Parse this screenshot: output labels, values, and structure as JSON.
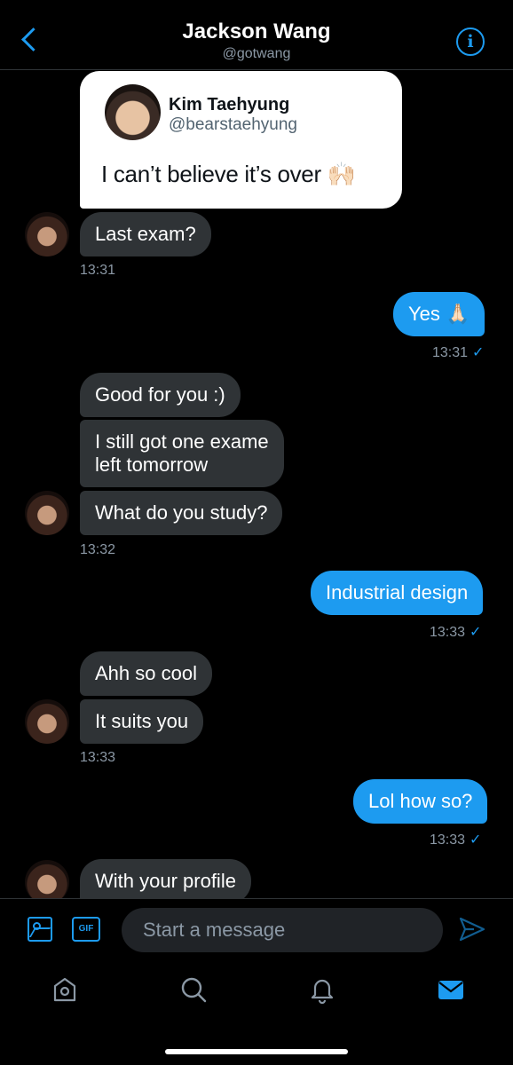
{
  "header": {
    "name": "Jackson Wang",
    "handle": "@gotwang"
  },
  "quoted_tweet": {
    "name": "Kim Taehyung",
    "handle": "@bearstaehyung",
    "text": "I can’t believe it’s over 🙌🏻"
  },
  "messages": [
    {
      "text": "Last exam?"
    },
    {
      "time": "13:31"
    },
    {
      "text": "Yes 🙏🏻"
    },
    {
      "time": "13:31"
    },
    {
      "text": "Good for you :)"
    },
    {
      "text": "I still got one exame"
    },
    {
      "text": "left tomorrow"
    },
    {
      "text": "What do you study?"
    },
    {
      "time": "13:32"
    },
    {
      "text": "Industrial design"
    },
    {
      "time": "13:33"
    },
    {
      "text": "Ahh so cool"
    },
    {
      "text": "It suits you"
    },
    {
      "time": "13:33"
    },
    {
      "text": "Lol how so?"
    },
    {
      "time": "13:33"
    },
    {
      "text": "With your profile"
    }
  ],
  "read_check": "✓",
  "composer": {
    "placeholder": "Start a message",
    "gif_label": "GIF"
  },
  "nav": {
    "items": [
      "home-icon",
      "search-icon",
      "notifications-icon",
      "messages-icon"
    ]
  },
  "colors": {
    "accent": "#1d9bf0",
    "incoming_bubble": "#2f3336",
    "background": "#000000"
  }
}
